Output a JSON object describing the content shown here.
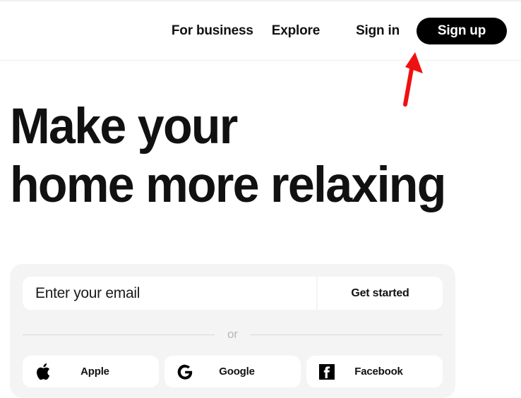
{
  "header": {
    "nav": [
      {
        "label": "For business",
        "name": "nav-link-for-business"
      },
      {
        "label": "Explore",
        "name": "nav-link-explore"
      },
      {
        "label": "Sign in",
        "name": "nav-link-sign-in"
      }
    ],
    "signup_label": "Sign up"
  },
  "hero": {
    "line1": "Make your",
    "line2": "home more relaxing"
  },
  "signup_card": {
    "email_placeholder": "Enter your email",
    "email_value": "",
    "get_started_label": "Get started",
    "divider_label": "or",
    "social": [
      {
        "label": "Apple",
        "icon": "apple-icon"
      },
      {
        "label": "Google",
        "icon": "google-icon"
      },
      {
        "label": "Facebook",
        "icon": "facebook-icon"
      }
    ]
  },
  "annotation": {
    "arrow_color": "#ef1111",
    "points_to": "Sign up"
  },
  "colors": {
    "page_background": "#ffffff",
    "card_background": "#f4f4f4",
    "text_primary": "#111111",
    "accent_button": "#000000",
    "divider": "#d6d6d6",
    "annotation_red": "#ef1111"
  }
}
